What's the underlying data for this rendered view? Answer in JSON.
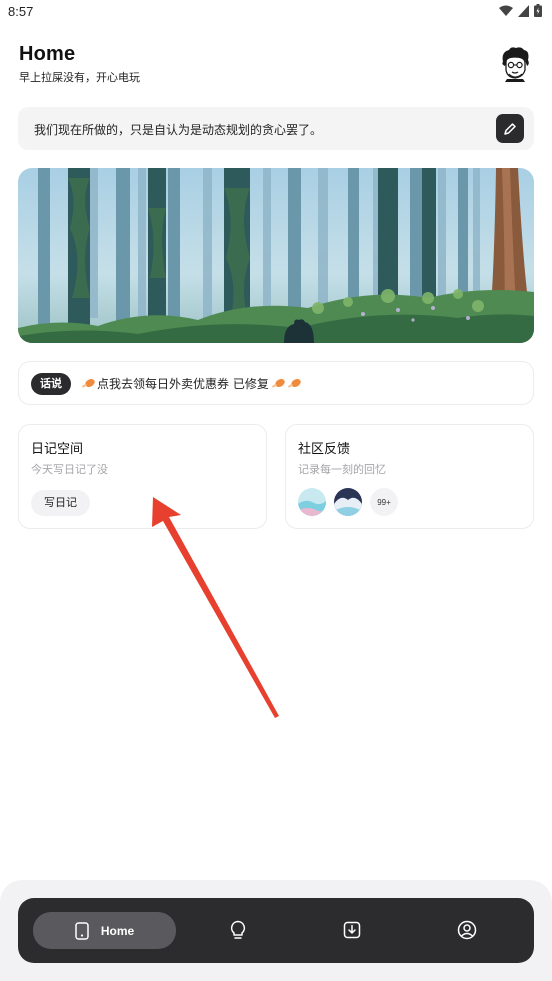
{
  "status_bar": {
    "time": "8:57",
    "icons": [
      "wifi-icon",
      "signal-icon",
      "battery-icon"
    ]
  },
  "header": {
    "title": "Home",
    "subtitle": "早上拉屎没有，开心电玩",
    "avatar_icon": "user-avatar"
  },
  "quote": {
    "text": "我们现在所做的，只是自认为是动态规划的贪心罢了。",
    "edit_icon": "pencil-icon"
  },
  "banner": {
    "image": "forest-illustration"
  },
  "notice": {
    "badge": "话说",
    "text": "点我去领每日外卖优惠券 已修复",
    "icon": "drumstick-icon"
  },
  "cards": {
    "diary": {
      "title": "日记空间",
      "subtitle": "今天写日记了没",
      "button": "写日记"
    },
    "community": {
      "title": "社区反馈",
      "subtitle": "记录每一刻的回忆",
      "count": "99+"
    }
  },
  "bottom_nav": {
    "items": [
      {
        "label": "Home",
        "icon": "phone-icon"
      },
      {
        "label": "",
        "icon": "lightbulb-icon"
      },
      {
        "label": "",
        "icon": "download-icon"
      },
      {
        "label": "",
        "icon": "profile-icon"
      }
    ]
  },
  "colors": {
    "annotation_arrow": "#e8402f",
    "nav_background": "#2c2c2e",
    "nav_active": "#5a5a5e"
  }
}
